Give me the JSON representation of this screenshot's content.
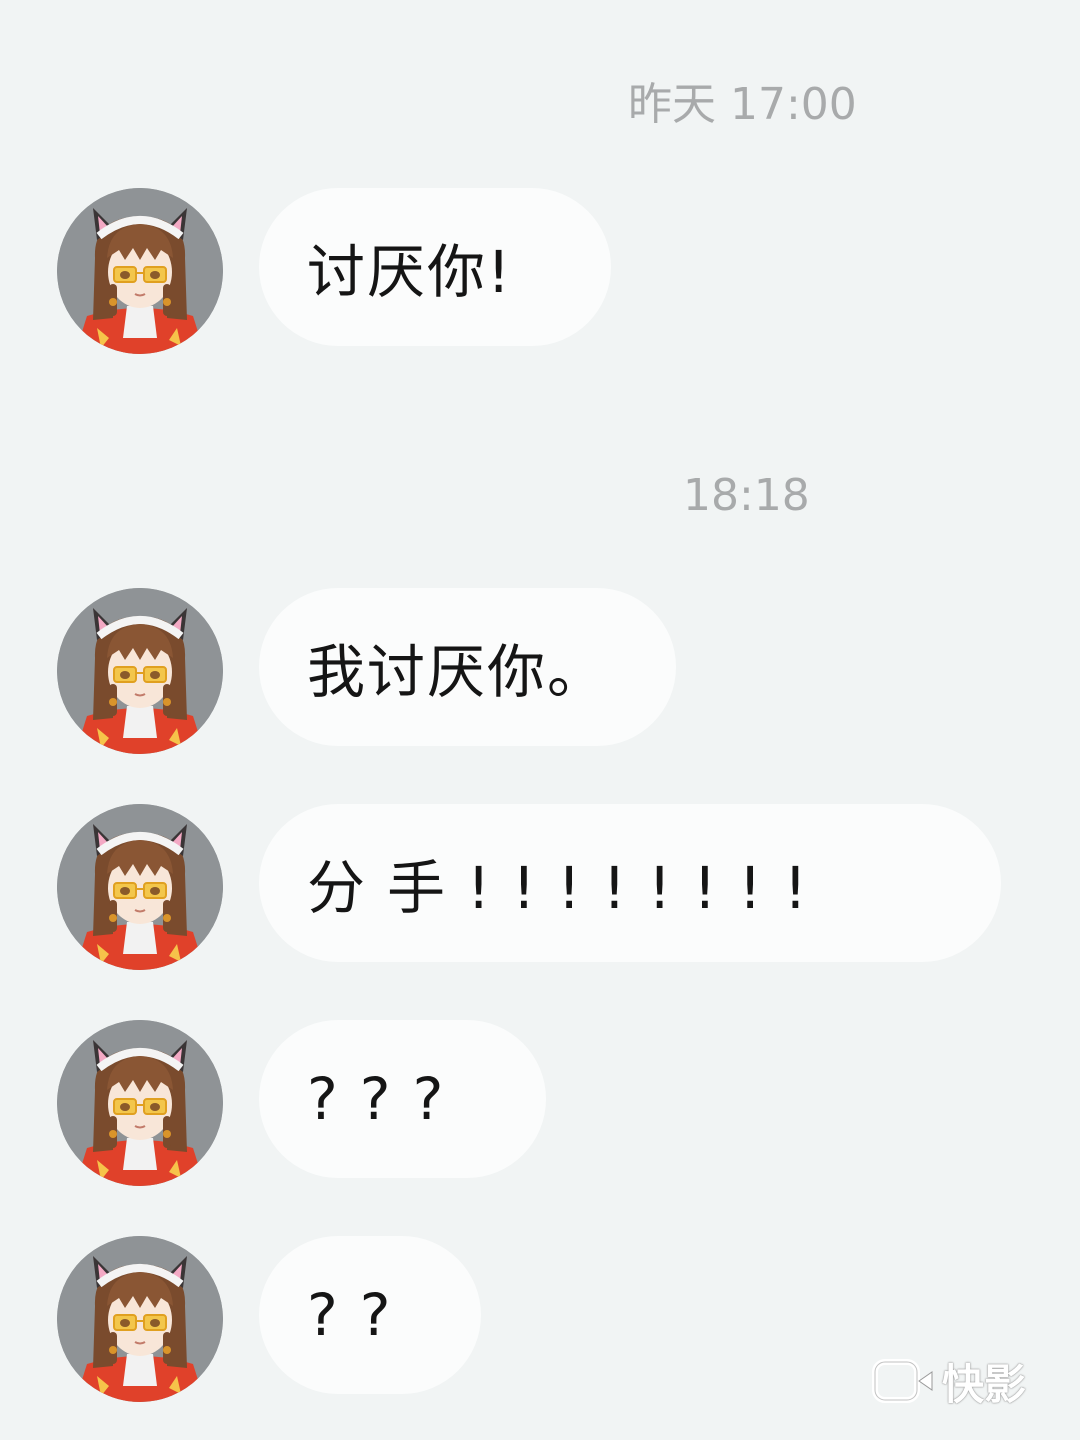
{
  "colors": {
    "background": "#f1f4f4",
    "bubble": "#fbfcfc",
    "timestamp_text": "#a8aaab",
    "message_text": "#151515"
  },
  "chat": {
    "timestamps": [
      "昨天 17:00",
      "18:18"
    ],
    "messages": [
      {
        "text": "讨厌你!",
        "avatar_icon": "anime-girl-cat-ears-avatar"
      },
      {
        "text": "我讨厌你。",
        "avatar_icon": "anime-girl-cat-ears-avatar"
      },
      {
        "text": "分手!!!!!!!!",
        "avatar_icon": "anime-girl-cat-ears-avatar"
      },
      {
        "text": "???",
        "avatar_icon": "anime-girl-cat-ears-avatar"
      },
      {
        "text": "??",
        "avatar_icon": "anime-girl-cat-ears-avatar"
      }
    ]
  },
  "watermark": {
    "icon": "video-camera-icon",
    "label": "快影"
  }
}
